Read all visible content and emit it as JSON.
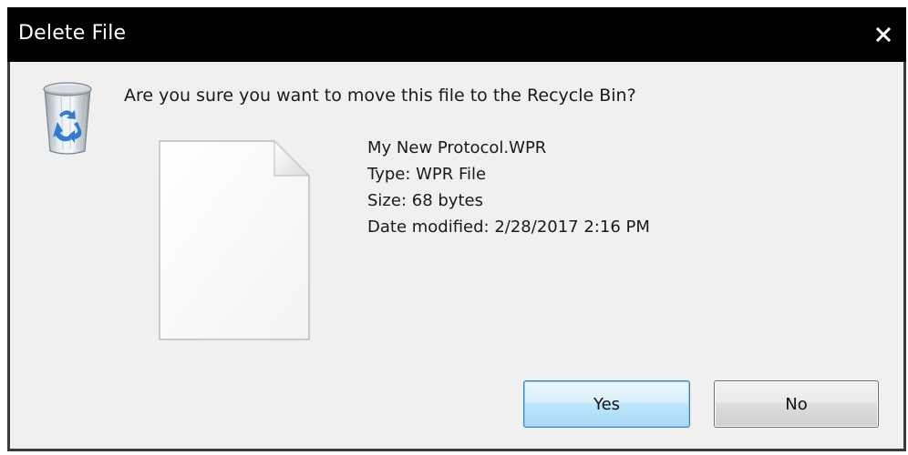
{
  "window": {
    "title": "Delete File",
    "close_glyph": "x"
  },
  "dialog": {
    "question": "Are you sure you want to move this file to the Recycle Bin?"
  },
  "file": {
    "name": "My New Protocol.WPR",
    "type": "Type: WPR File",
    "size": "Size: 68 bytes",
    "date_modified": "Date modified: 2/28/2017 2:16 PM",
    "icon": "blank-document-icon"
  },
  "buttons": {
    "yes_label": "Yes",
    "no_label": "No"
  },
  "icons": {
    "header": "recycle-bin-icon",
    "close": "close-icon"
  },
  "colors": {
    "titlebar": "#000000",
    "dialog_background": "#f0f0f0",
    "default_button": "#bee6fd"
  }
}
